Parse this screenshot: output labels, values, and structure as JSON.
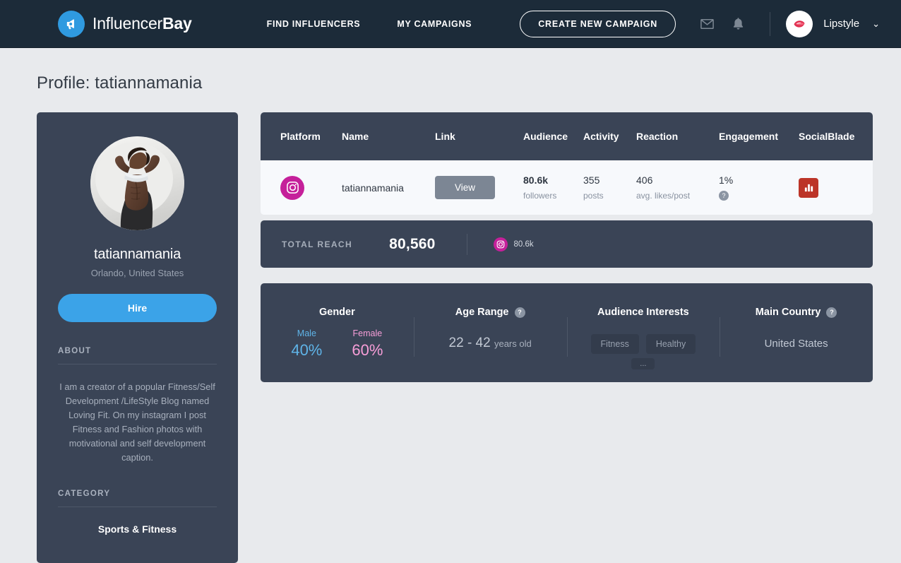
{
  "header": {
    "brand_light": "Influencer",
    "brand_bold": "Bay",
    "logo_icon": "megaphone-icon",
    "nav": [
      {
        "label": "FIND INFLUENCERS"
      },
      {
        "label": "MY CAMPAIGNS"
      }
    ],
    "cta_label": "CREATE NEW CAMPAIGN",
    "mail_icon": "envelope-icon",
    "bell_icon": "bell-icon",
    "avatar_icon": "lips-avatar",
    "user_name": "Lipstyle",
    "chevron": "⌄",
    "bg_color": "#1c2b39"
  },
  "page": {
    "title": "Profile: tatiannamania",
    "bg_color": "#e8eaed"
  },
  "profile": {
    "avatar_alt": "fitness-photo-avatar",
    "name": "tatiannamania",
    "location": "Orlando, United States",
    "hire_label": "Hire",
    "hire_color": "#3ba3e8",
    "about_label": "ABOUT",
    "about_text": "I am a creator of a popular Fitness/Self Development /LifeStyle Blog named Loving Fit. On my instagram I post Fitness and Fashion photos with motivational and self development caption.",
    "category_label": "CATEGORY",
    "category_value": "Sports & Fitness",
    "card_color": "#3a4456"
  },
  "table": {
    "columns": [
      "Platform",
      "Name",
      "Link",
      "Audience",
      "Activity",
      "Reaction",
      "Engagement",
      "SocialBlade"
    ],
    "row": {
      "platform_icon": "instagram-icon",
      "platform_color": "#c5209a",
      "name": "tatiannamania",
      "link_label": "View",
      "audience_value": "80.6k",
      "audience_sub": "followers",
      "activity_value": "355",
      "activity_sub": "posts",
      "reaction_value": "406",
      "reaction_sub": "avg. likes/post",
      "engagement_value": "1%",
      "engagement_help": "?",
      "socialblade_icon": "bar-chart-icon",
      "socialblade_color": "#bc3528"
    }
  },
  "reach": {
    "label": "TOTAL REACH",
    "value": "80,560",
    "chip_icon": "instagram-icon",
    "chip_value": "80.6k"
  },
  "demographics": {
    "gender": {
      "title": "Gender",
      "male_label": "Male",
      "male_value": "40%",
      "male_color": "#5fb4e8",
      "female_label": "Female",
      "female_value": "60%",
      "female_color": "#f79ed8"
    },
    "age": {
      "title": "Age Range",
      "help": "?",
      "range": "22 - 42",
      "unit": "years old"
    },
    "interests": {
      "title": "Audience Interests",
      "tags": [
        "Fitness",
        "Healthy"
      ],
      "more": "..."
    },
    "country": {
      "title": "Main Country",
      "help": "?",
      "value": "United States"
    }
  }
}
